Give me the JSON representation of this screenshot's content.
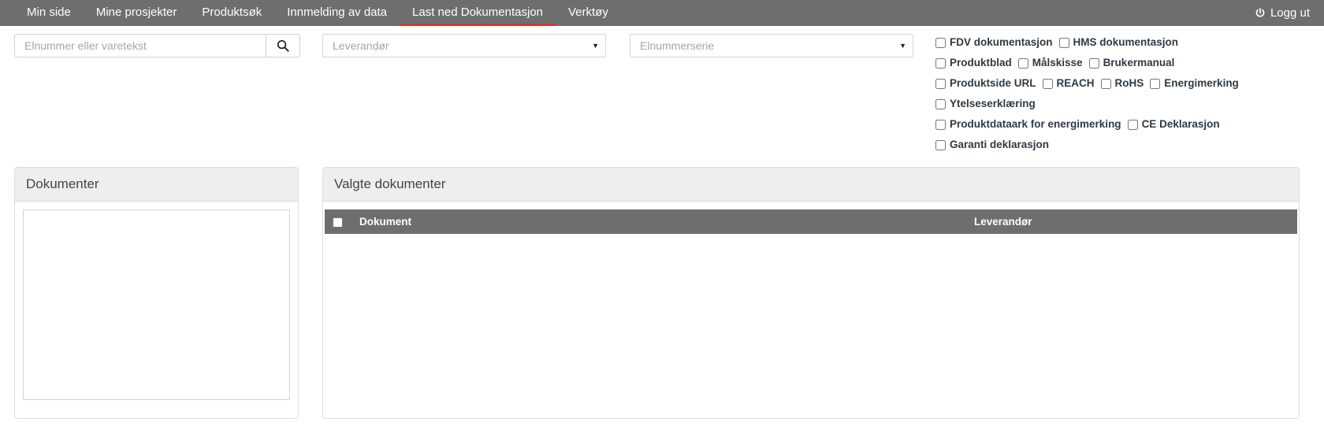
{
  "navbar": {
    "items": [
      {
        "label": "Min side",
        "active": false
      },
      {
        "label": "Mine prosjekter",
        "active": false
      },
      {
        "label": "Produktsøk",
        "active": false
      },
      {
        "label": "Innmelding av data",
        "active": false
      },
      {
        "label": "Last ned Dokumentasjon",
        "active": true
      },
      {
        "label": "Verktøy",
        "active": false
      }
    ],
    "logout_label": "Logg ut",
    "logout_icon": "power-icon",
    "background_color": "#6e6e6e",
    "active_underline_color": "#d9342b"
  },
  "filters": {
    "search": {
      "placeholder": "Elnummer eller varetekst",
      "value": "",
      "button_icon": "search-icon"
    },
    "supplier_select": {
      "selected": "Leverandør",
      "caret_icon": "chevron-down-icon"
    },
    "series_select": {
      "selected": "Elnummerserie",
      "caret_icon": "chevron-down-icon"
    },
    "checkbox_rows": [
      [
        {
          "label": "FDV dokumentasjon",
          "checked": false
        },
        {
          "label": "HMS dokumentasjon",
          "checked": false
        }
      ],
      [
        {
          "label": "Produktblad",
          "checked": false
        },
        {
          "label": "Målskisse",
          "checked": false
        },
        {
          "label": "Brukermanual",
          "checked": false
        }
      ],
      [
        {
          "label": "Produktside URL",
          "checked": false
        },
        {
          "label": "REACH",
          "checked": false
        },
        {
          "label": "RoHS",
          "checked": false
        },
        {
          "label": "Energimerking",
          "checked": false
        }
      ],
      [
        {
          "label": "Ytelseserklæring",
          "checked": false
        }
      ],
      [
        {
          "label": "Produktdataark for energimerking",
          "checked": false
        },
        {
          "label": "CE Deklarasjon",
          "checked": false
        }
      ],
      [
        {
          "label": "Garanti deklarasjon",
          "checked": false
        }
      ]
    ]
  },
  "documents_panel": {
    "title": "Dokumenter",
    "items": []
  },
  "selected_documents_panel": {
    "title": "Valgte dokumenter",
    "table": {
      "select_all_checked": false,
      "columns": [
        "Dokument",
        "Leverandør"
      ],
      "rows": []
    }
  }
}
